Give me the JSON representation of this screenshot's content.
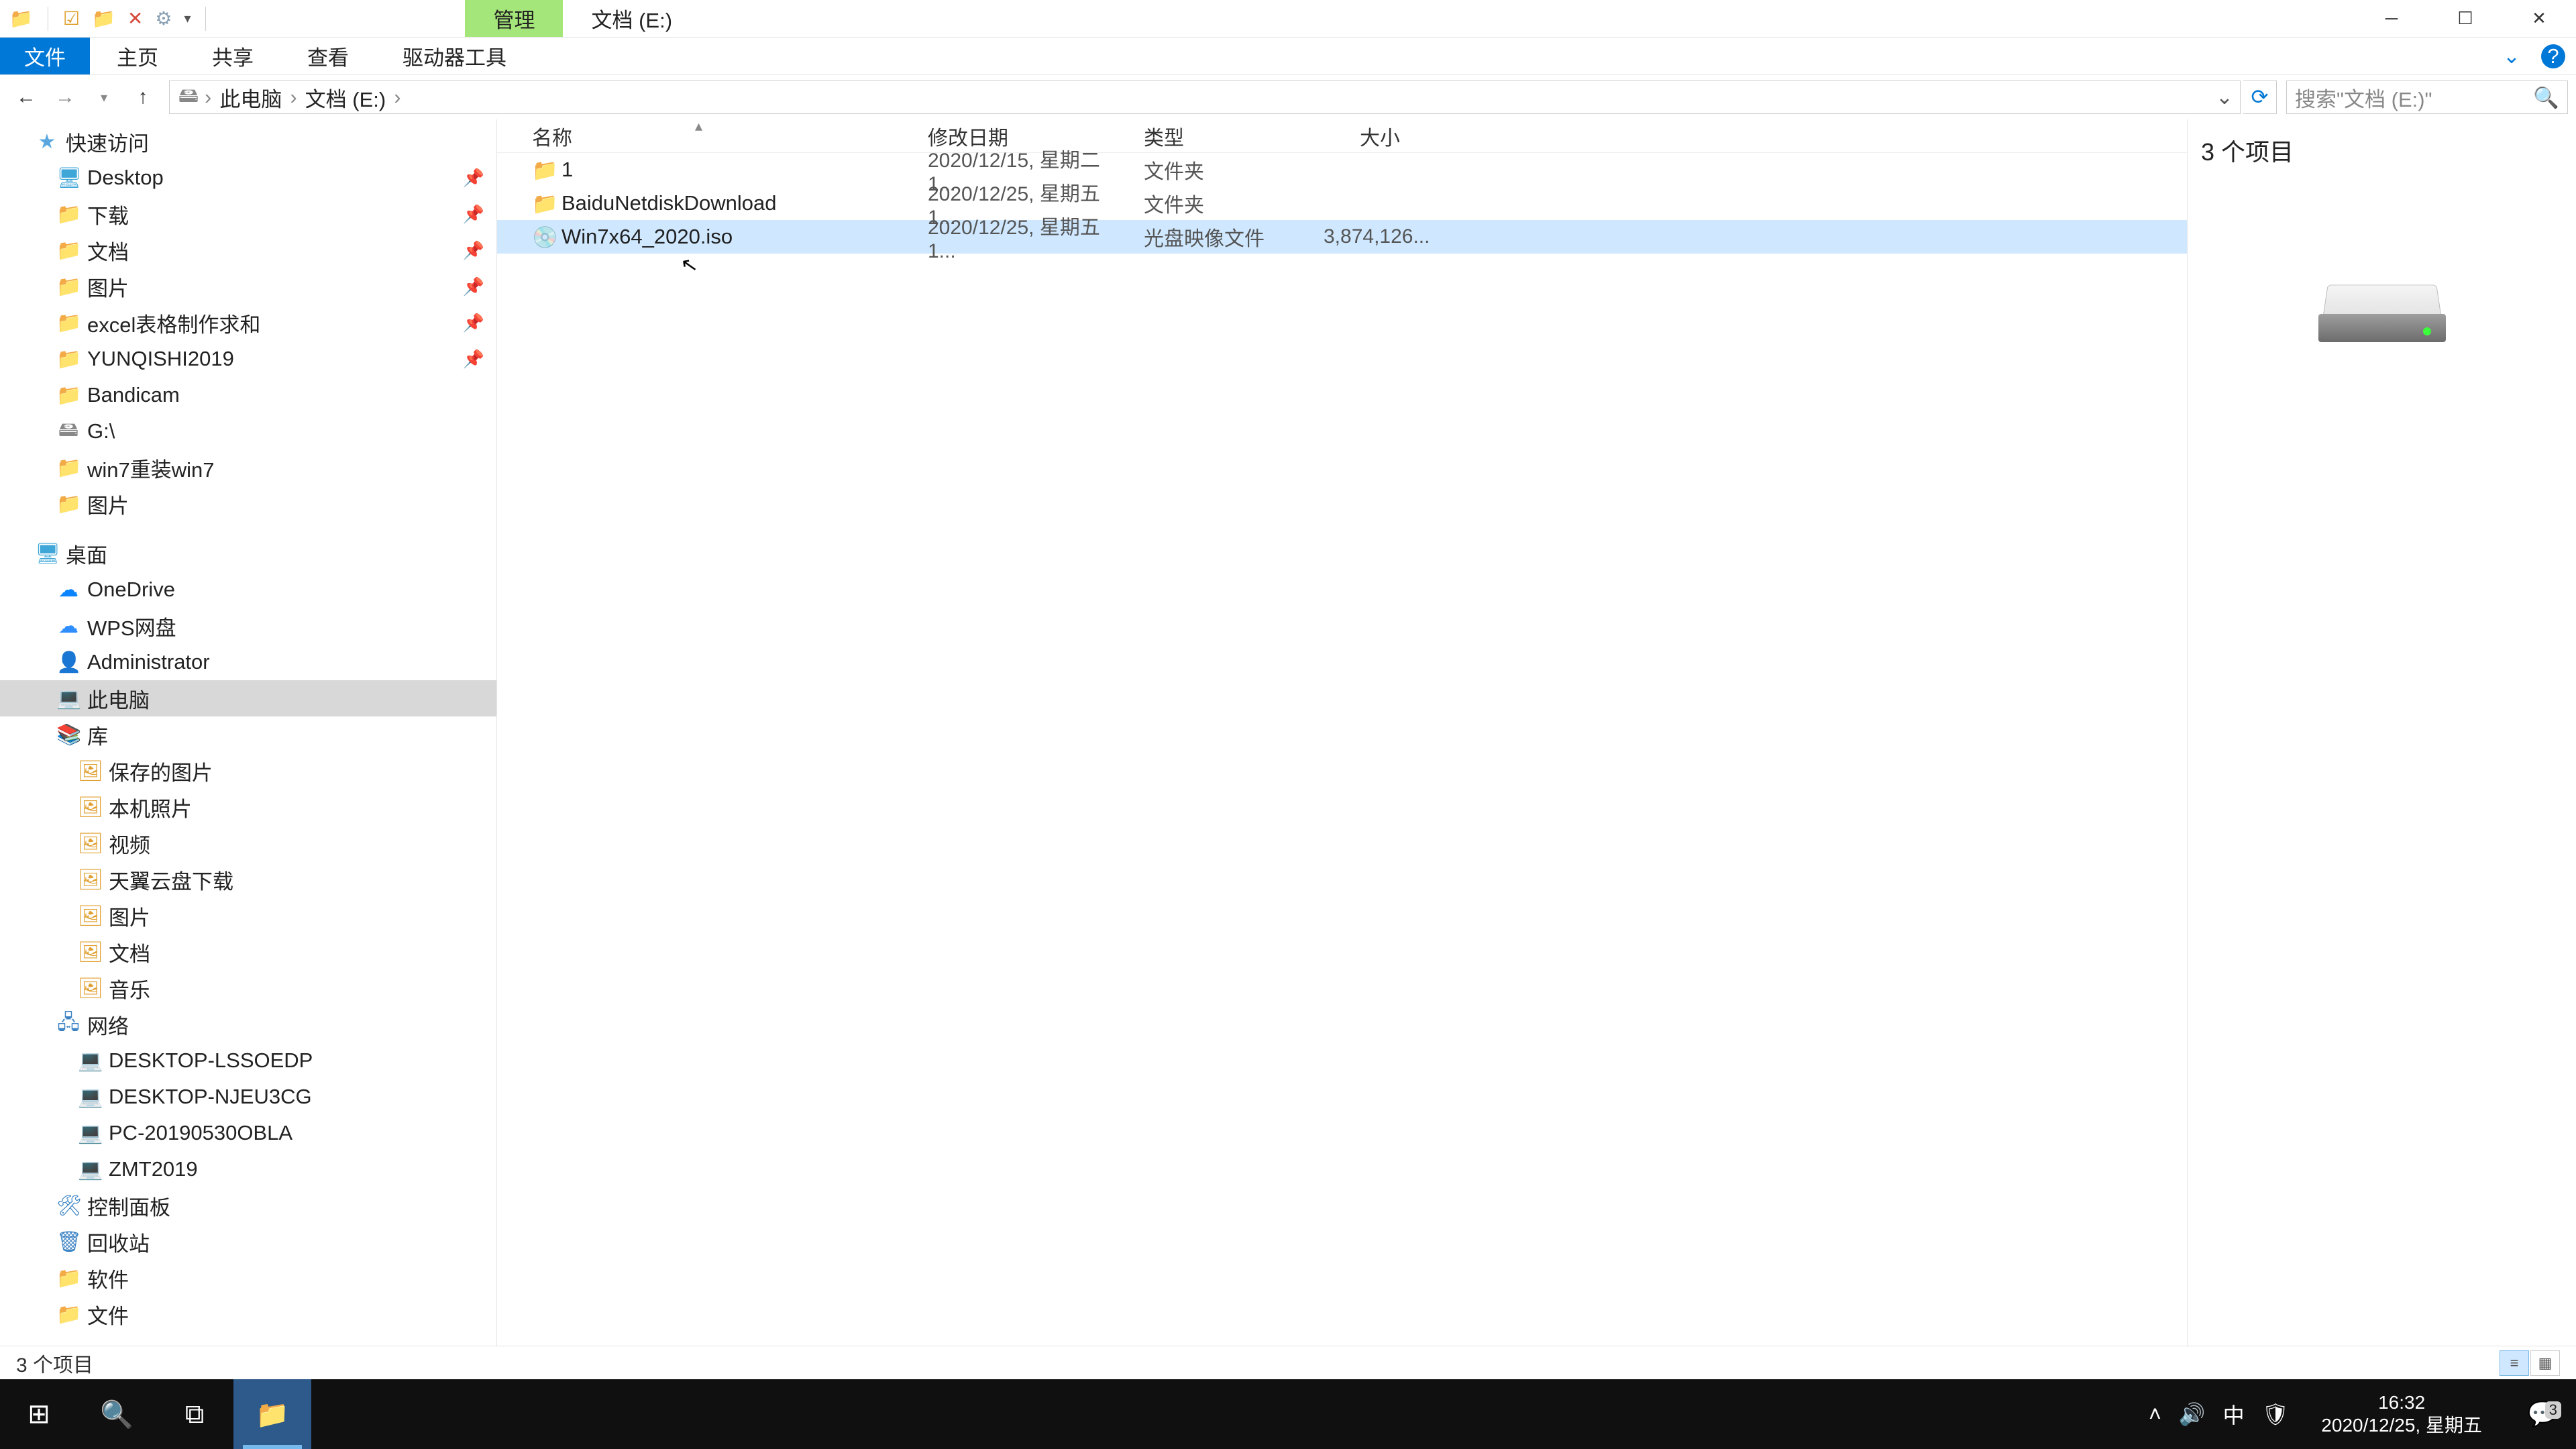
{
  "title": {
    "context_tab": "管理",
    "location_tab": "文档 (E:)"
  },
  "ribbon": {
    "file": "文件",
    "home": "主页",
    "share": "共享",
    "view": "查看",
    "drive_tools": "驱动器工具"
  },
  "address": {
    "crumbs": [
      "此电脑",
      "文档 (E:)"
    ]
  },
  "search": {
    "placeholder": "搜索\"文档 (E:)\""
  },
  "nav": {
    "quick_access": "快速访问",
    "quick_items": [
      {
        "icon": "desktop",
        "label": "Desktop",
        "pinned": true
      },
      {
        "icon": "folder",
        "label": "下载",
        "pinned": true
      },
      {
        "icon": "folder",
        "label": "文档",
        "pinned": true
      },
      {
        "icon": "folder",
        "label": "图片",
        "pinned": true
      },
      {
        "icon": "folder",
        "label": "excel表格制作求和",
        "pinned": true
      },
      {
        "icon": "folder",
        "label": "YUNQISHI2019",
        "pinned": true
      },
      {
        "icon": "folder",
        "label": "Bandicam",
        "pinned": false
      },
      {
        "icon": "drive",
        "label": "G:\\",
        "pinned": false
      },
      {
        "icon": "folder",
        "label": "win7重装win7",
        "pinned": false
      },
      {
        "icon": "folder",
        "label": "图片",
        "pinned": false
      }
    ],
    "desktop": "桌面",
    "desktop_items": [
      {
        "icon": "onedrive",
        "label": "OneDrive"
      },
      {
        "icon": "wps",
        "label": "WPS网盘"
      },
      {
        "icon": "user",
        "label": "Administrator"
      },
      {
        "icon": "pc",
        "label": "此电脑",
        "selected": true
      },
      {
        "icon": "lib",
        "label": "库"
      }
    ],
    "lib_items": [
      {
        "label": "保存的图片"
      },
      {
        "label": "本机照片"
      },
      {
        "label": "视频"
      },
      {
        "label": "天翼云盘下载"
      },
      {
        "label": "图片"
      },
      {
        "label": "文档"
      },
      {
        "label": "音乐"
      }
    ],
    "network": "网络",
    "net_items": [
      {
        "label": "DESKTOP-LSSOEDP"
      },
      {
        "label": "DESKTOP-NJEU3CG"
      },
      {
        "label": "PC-20190530OBLA"
      },
      {
        "label": "ZMT2019"
      }
    ],
    "control_panel": "控制面板",
    "recycle": "回收站",
    "software": "软件",
    "docs": "文件"
  },
  "columns": {
    "name": "名称",
    "date": "修改日期",
    "type": "类型",
    "size": "大小"
  },
  "files": [
    {
      "icon": "folder",
      "name": "1",
      "date": "2020/12/15, 星期二 1...",
      "type": "文件夹",
      "size": ""
    },
    {
      "icon": "folder",
      "name": "BaiduNetdiskDownload",
      "date": "2020/12/25, 星期五 1...",
      "type": "文件夹",
      "size": ""
    },
    {
      "icon": "iso",
      "name": "Win7x64_2020.iso",
      "date": "2020/12/25, 星期五 1...",
      "type": "光盘映像文件",
      "size": "3,874,126..."
    }
  ],
  "preview": {
    "count": "3 个项目"
  },
  "status": {
    "text": "3 个项目"
  },
  "tray": {
    "ime": "中",
    "time": "16:32",
    "date": "2020/12/25, 星期五",
    "notif_count": "3"
  }
}
